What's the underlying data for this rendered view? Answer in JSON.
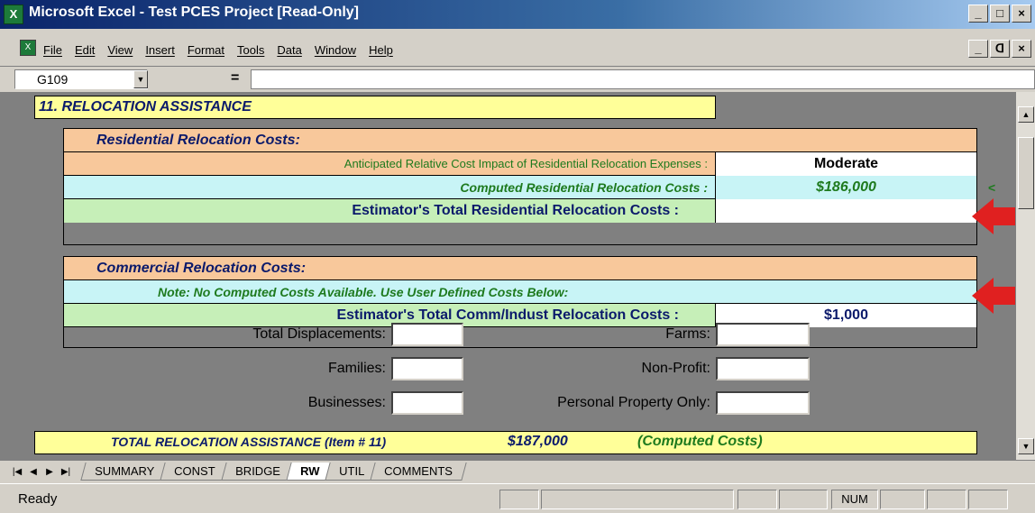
{
  "window": {
    "title": "Microsoft Excel - Test PCES Project  [Read-Only]",
    "app_icon": "X",
    "doc_icon": "X",
    "btn_minimize": "_",
    "btn_maximize": "□",
    "btn_close": "×",
    "btn_restore": "ᗡ"
  },
  "menu": {
    "items": [
      "File",
      "Edit",
      "View",
      "Insert",
      "Format",
      "Tools",
      "Data",
      "Window",
      "Help"
    ]
  },
  "formula_bar": {
    "cell_ref": "G109",
    "dropdown": "▼",
    "equals": "="
  },
  "sheet": {
    "section_title": "11. RELOCATION ASSISTANCE",
    "residential": {
      "title": "Residential Relocation Costs:",
      "impact_label": "Anticipated Relative Cost Impact of Residential Relocation Expenses :",
      "impact_value": "Moderate",
      "computed_label": "Computed Residential Relocation Costs :",
      "computed_value": "$186,000",
      "estimator_label": "Estimator's Total Residential Relocation Costs :",
      "estimator_value": "",
      "marker": "<"
    },
    "commercial": {
      "title": "Commercial Relocation Costs:",
      "note": "Note:  No Computed Costs Available.  Use User Defined Costs Below:",
      "estimator_label": "Estimator's Total Comm/Indust Relocation Costs :",
      "estimator_value": "$1,000"
    },
    "fields": {
      "total_displacements": "Total Displacements:",
      "families": "Families:",
      "businesses": "Businesses:",
      "farms": "Farms:",
      "non_profit": "Non-Profit:",
      "personal_property": "Personal Property Only:"
    },
    "total": {
      "label": "TOTAL RELOCATION ASSISTANCE  (Item # 11)",
      "value": "$187,000",
      "note": "(Computed Costs)"
    },
    "colors": {
      "accent_red": "#e02020",
      "navy": "#0b1a6b",
      "green": "#1e7a1e"
    }
  },
  "tabs": [
    "SUMMARY",
    "CONST",
    "BRIDGE",
    "RW",
    "UTIL",
    "COMMENTS"
  ],
  "tab_nav": [
    "|◀",
    "◀",
    "▶",
    "▶|"
  ],
  "status": {
    "text": "Ready",
    "num": "NUM"
  }
}
